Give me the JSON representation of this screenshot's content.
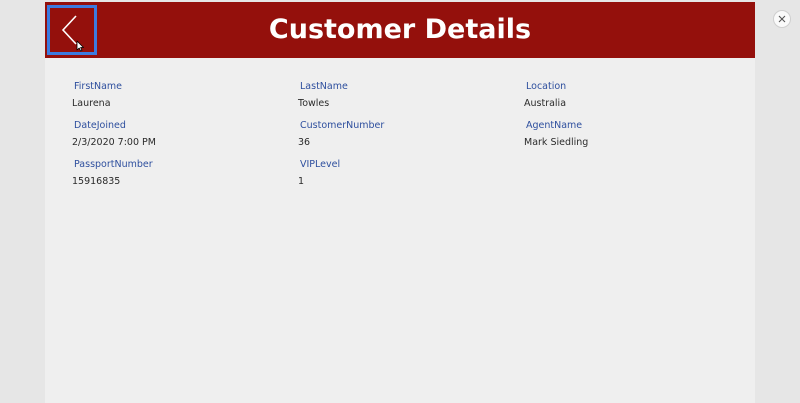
{
  "header": {
    "title": "Customer Details"
  },
  "fields": {
    "first_name": {
      "label": "FirstName",
      "value": "Laurena"
    },
    "last_name": {
      "label": "LastName",
      "value": "Towles"
    },
    "location": {
      "label": "Location",
      "value": "Australia"
    },
    "date_joined": {
      "label": "DateJoined",
      "value": "2/3/2020 7:00 PM"
    },
    "customer_number": {
      "label": "CustomerNumber",
      "value": "36"
    },
    "agent_name": {
      "label": "AgentName",
      "value": "Mark Siedling"
    },
    "passport_number": {
      "label": "PassportNumber",
      "value": "15916835"
    },
    "vip_level": {
      "label": "VIPLevel",
      "value": "1"
    }
  },
  "colors": {
    "header_bg": "#94100c",
    "selection_border": "#3c7be0",
    "label_text": "#2e4f9e",
    "value_text": "#2b2b2b",
    "canvas_bg": "#efefef",
    "outer_bg": "#e6e6e6"
  },
  "icons": {
    "back": "chevron-left-icon",
    "cursor": "mouse-pointer-icon",
    "close": "close-icon"
  }
}
